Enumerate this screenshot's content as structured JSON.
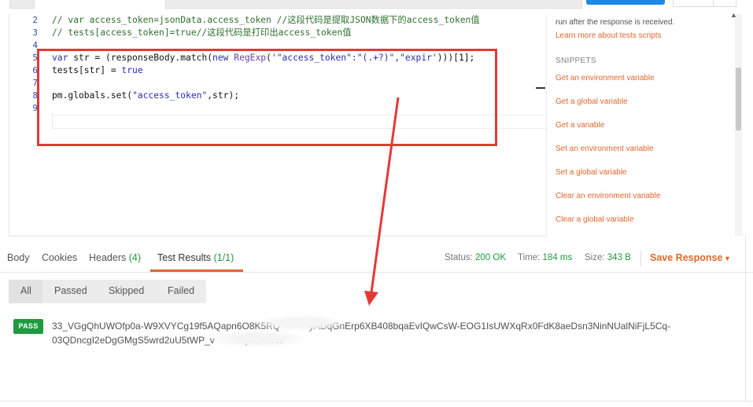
{
  "editor": {
    "lines": [
      {
        "n": "2",
        "code": [
          {
            "cls": "c",
            "text": "// var access_token=jsonData.access_token //这段代码是提取JSON数据下的access_token值"
          }
        ]
      },
      {
        "n": "3",
        "code": [
          {
            "cls": "c",
            "text": "// tests[access_token]=true//这段代码是打印出access_token值"
          }
        ]
      },
      {
        "n": "4",
        "code": []
      },
      {
        "n": "5",
        "code": [
          {
            "cls": "k",
            "text": "var"
          },
          {
            "cls": "t",
            "text": " str = (responseBody.match("
          },
          {
            "cls": "k",
            "text": "new"
          },
          {
            "cls": "t",
            "text": " "
          },
          {
            "cls": "f",
            "text": "RegExp"
          },
          {
            "cls": "t",
            "text": "("
          },
          {
            "cls": "s",
            "text": "'\"access_token\":\"(.+?)\",\"expir'"
          },
          {
            "cls": "t",
            "text": ")))[1];"
          }
        ]
      },
      {
        "n": "6",
        "code": [
          {
            "cls": "t",
            "text": "tests[str] = "
          },
          {
            "cls": "k",
            "text": "true"
          }
        ]
      },
      {
        "n": "7",
        "code": []
      },
      {
        "n": "8",
        "code": [
          {
            "cls": "t",
            "text": "pm.globals.set("
          },
          {
            "cls": "s",
            "text": "\"access_token\""
          },
          {
            "cls": "t",
            "text": ",str);"
          }
        ]
      },
      {
        "n": "9",
        "code": []
      }
    ]
  },
  "right_panel": {
    "description": "run after the response is received.",
    "learn_link": "Learn more about tests scripts",
    "snippets_heading": "SNIPPETS",
    "snippets": [
      "Get an environment variable",
      "Get a global variable",
      "Get a variable",
      "Set an environment variable",
      "Set a global variable",
      "Clear an environment variable",
      "Clear a global variable"
    ]
  },
  "response_tabs": {
    "body": "Body",
    "cookies": "Cookies",
    "headers": "Headers",
    "headers_count": "(4)",
    "test_results": "Test Results",
    "test_results_count": "(1/1)"
  },
  "status": {
    "status_label": "Status:",
    "status_value": "200 OK",
    "time_label": "Time:",
    "time_value": "184 ms",
    "size_label": "Size:",
    "size_value": "343 B",
    "save_response": "Save Response"
  },
  "filters": [
    "All",
    "Passed",
    "Skipped",
    "Failed"
  ],
  "result": {
    "badge": "PASS",
    "text_line1": "33_VGgQhUWOfp0a-W9XVYCg19f5AQapn6O8K5RQ           yADqGnErp6XB408bqaEvIQwCsW-EOG1IsUWXqRx0FdK8aeDsn3NinNUalNiFjL5Cq-",
    "text_line2": "03QDncgI2eDgGMgS5wrd2uU5tWP_v          JjACANVF"
  },
  "colors": {
    "accent_orange": "#e0662c",
    "pass_green": "#1f9a3f",
    "annotation_red": "#e53935",
    "send_blue": "#1e88e5"
  }
}
